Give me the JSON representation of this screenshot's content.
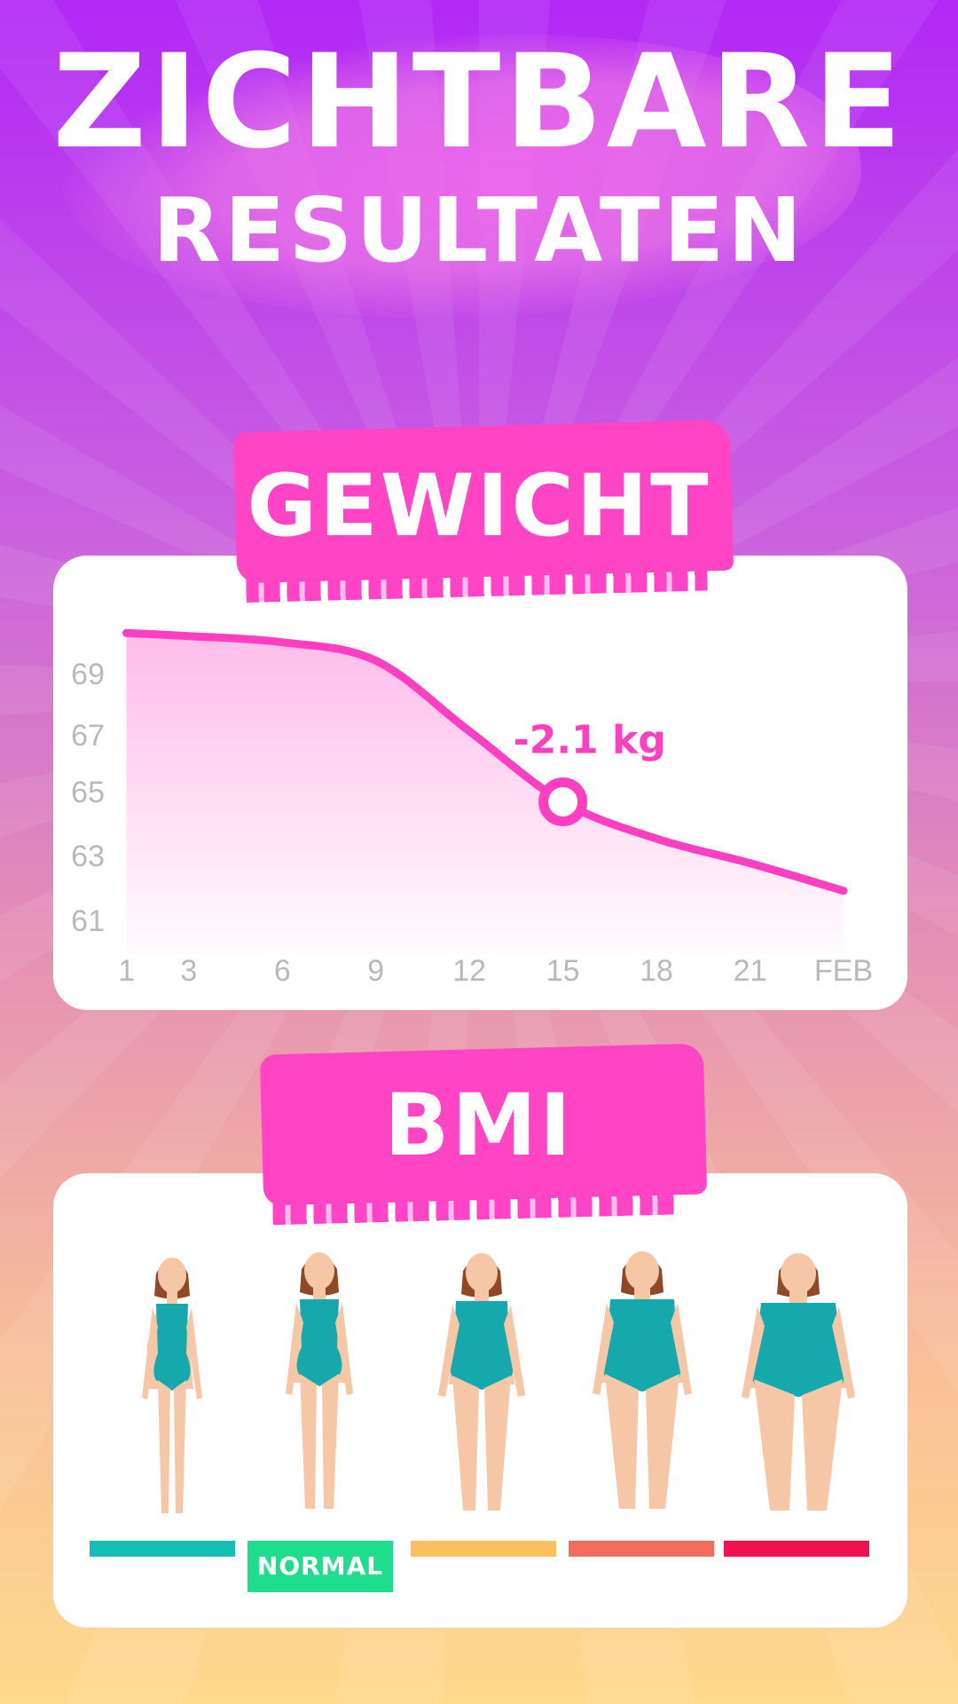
{
  "header": {
    "line1": "ZICHTBARE",
    "line2": "RESULTATEN"
  },
  "weight": {
    "title": "GEWICHT",
    "annotation": "-2.1 kg",
    "colors": {
      "line": "#ff3fc2",
      "marker": "#ff3fc2"
    }
  },
  "chart_data": {
    "type": "area",
    "x_ticks": [
      "1",
      "3",
      "6",
      "9",
      "12",
      "15",
      "18",
      "21",
      "FEB"
    ],
    "y_ticks": [
      "69",
      "67",
      "65",
      "63",
      "61"
    ],
    "x": [
      1,
      3,
      6,
      9,
      12,
      15,
      18,
      21,
      24
    ],
    "values": [
      70.8,
      70.7,
      70.5,
      69.9,
      67.6,
      65.3,
      64.1,
      63.3,
      62.4
    ],
    "marker": {
      "x": 15,
      "y": 65.3,
      "label": "-2.1 kg"
    },
    "ylim": [
      60.6,
      71.3
    ],
    "xlim": [
      0.7,
      24.4
    ],
    "grid": false,
    "title": "GEWICHT"
  },
  "bmi": {
    "title": "BMI",
    "badge": "NORMAL",
    "bar_colors": [
      "#16bfb4",
      "#1ede8d",
      "#f9c05f",
      "#f36d5e",
      "#f0114f"
    ],
    "figures": [
      "body-very-slim-icon",
      "body-normal-icon",
      "body-overweight-icon",
      "body-obese-icon",
      "body-very-obese-icon"
    ]
  }
}
